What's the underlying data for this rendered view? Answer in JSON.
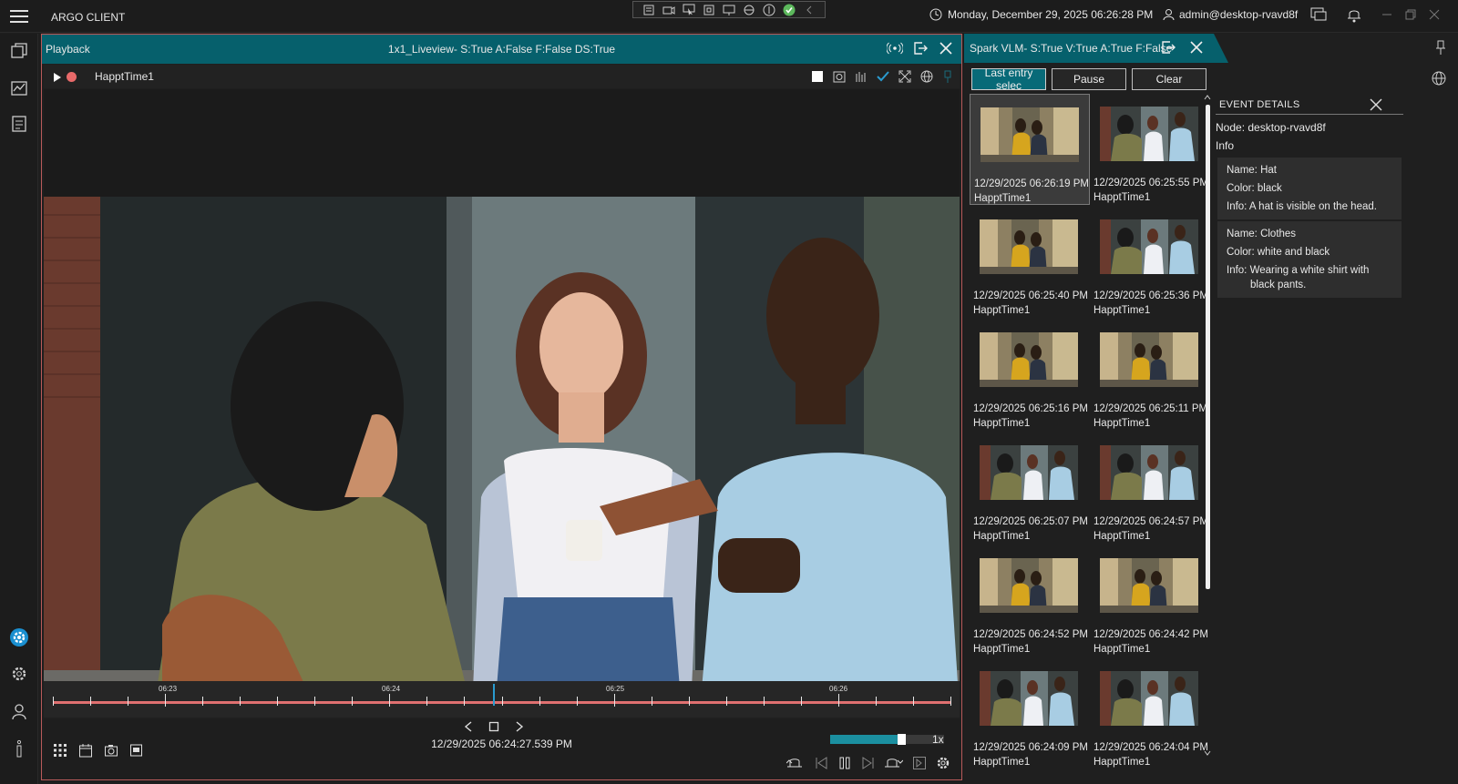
{
  "app": {
    "title": "ARGO CLIENT"
  },
  "topbar": {
    "datetime": "Monday, December 29, 2025 06:26:28 PM",
    "user": "admin@desktop-rvavd8f"
  },
  "playback": {
    "tab_label": "Playback",
    "layout_title": "1x1_Liveview- S:True A:False F:False DS:True",
    "camera_name": "HapptTime1",
    "timeline_labels": [
      "06:23",
      "06:24",
      "06:25",
      "06:26"
    ],
    "current_time": "12/29/2025 06:24:27.539 PM",
    "speed_label": "1x",
    "speed_fraction": 0.62,
    "cursor_fraction": 0.49
  },
  "spark": {
    "tab_label": "Spark VLM- S:True V:True A:True F:False",
    "buttons": {
      "last_entry": "Last entry selec",
      "pause": "Pause",
      "clear": "Clear"
    },
    "entries": [
      {
        "timestamp": "12/29/2025 06:26:19 PM",
        "camera": "HapptTime1",
        "selected": true,
        "variant": "a"
      },
      {
        "timestamp": "12/29/2025 06:25:55 PM",
        "camera": "HapptTime1",
        "selected": false,
        "variant": "b"
      },
      {
        "timestamp": "12/29/2025 06:25:40 PM",
        "camera": "HapptTime1",
        "selected": false,
        "variant": "a"
      },
      {
        "timestamp": "12/29/2025 06:25:36 PM",
        "camera": "HapptTime1",
        "selected": false,
        "variant": "b"
      },
      {
        "timestamp": "12/29/2025 06:25:16 PM",
        "camera": "HapptTime1",
        "selected": false,
        "variant": "a"
      },
      {
        "timestamp": "12/29/2025 06:25:11 PM",
        "camera": "HapptTime1",
        "selected": false,
        "variant": "a"
      },
      {
        "timestamp": "12/29/2025 06:25:07 PM",
        "camera": "HapptTime1",
        "selected": false,
        "variant": "b"
      },
      {
        "timestamp": "12/29/2025 06:24:57 PM",
        "camera": "HapptTime1",
        "selected": false,
        "variant": "b"
      },
      {
        "timestamp": "12/29/2025 06:24:52 PM",
        "camera": "HapptTime1",
        "selected": false,
        "variant": "a"
      },
      {
        "timestamp": "12/29/2025 06:24:42 PM",
        "camera": "HapptTime1",
        "selected": false,
        "variant": "a"
      },
      {
        "timestamp": "12/29/2025 06:24:09 PM",
        "camera": "HapptTime1",
        "selected": false,
        "variant": "b"
      },
      {
        "timestamp": "12/29/2025 06:24:04 PM",
        "camera": "HapptTime1",
        "selected": false,
        "variant": "b"
      }
    ]
  },
  "event_details": {
    "title": "EVENT DETAILS",
    "node": "Node: desktop-rvavd8f",
    "info_label": "Info",
    "items": [
      {
        "name": "Name: Hat",
        "color": "Color: black",
        "info": "Info: A hat is visible on the head."
      },
      {
        "name": "Name: Clothes",
        "color": "Color: white and black",
        "info": "Info: Wearing a white shirt with black pants."
      }
    ]
  },
  "colors": {
    "accent": "#06606c",
    "timeline": "#e07070",
    "cursor": "#2a9bd0",
    "selected_border": "#b85a5a"
  },
  "icons": [
    "hamburger-icon",
    "clock-icon",
    "user-icon",
    "chat-icon",
    "bell-icon",
    "gear-icon",
    "globe-icon",
    "pin-icon",
    "close-icon",
    "export-icon",
    "broadcast-icon"
  ]
}
